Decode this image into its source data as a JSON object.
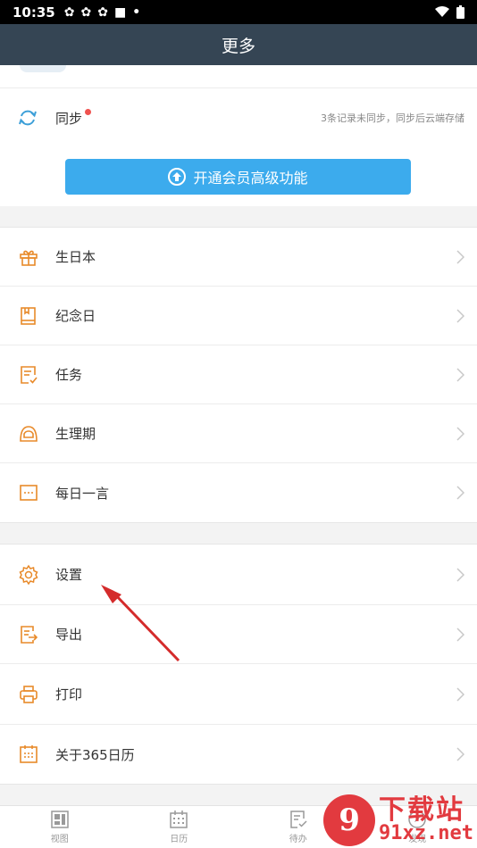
{
  "status_bar": {
    "time": "10:35"
  },
  "header": {
    "title": "更多"
  },
  "sync": {
    "label": "同步",
    "hint": "3条记录未同步，同步后云端存储"
  },
  "vip_button": {
    "label": "开通会员高级功能"
  },
  "group1": [
    {
      "label": "生日本",
      "icon": "gift-icon"
    },
    {
      "label": "纪念日",
      "icon": "book-icon"
    },
    {
      "label": "任务",
      "icon": "task-icon"
    },
    {
      "label": "生理期",
      "icon": "period-icon"
    },
    {
      "label": "每日一言",
      "icon": "quote-icon"
    }
  ],
  "group2": [
    {
      "label": "设置",
      "icon": "gear-icon"
    },
    {
      "label": "导出",
      "icon": "export-icon"
    },
    {
      "label": "打印",
      "icon": "printer-icon"
    },
    {
      "label": "关于365日历",
      "icon": "calendar-icon"
    }
  ],
  "tabbar": [
    {
      "label": "视图"
    },
    {
      "label": "日历"
    },
    {
      "label": "待办"
    },
    {
      "label": "发现"
    }
  ],
  "watermark": {
    "title": "下载站",
    "domain": "91xz.net",
    "logo": "9"
  },
  "colors": {
    "header": "#354554",
    "accent": "#3cabed",
    "icon": "#e88a2a",
    "badge": "#f0524f",
    "arrow": "#d42b2b"
  }
}
